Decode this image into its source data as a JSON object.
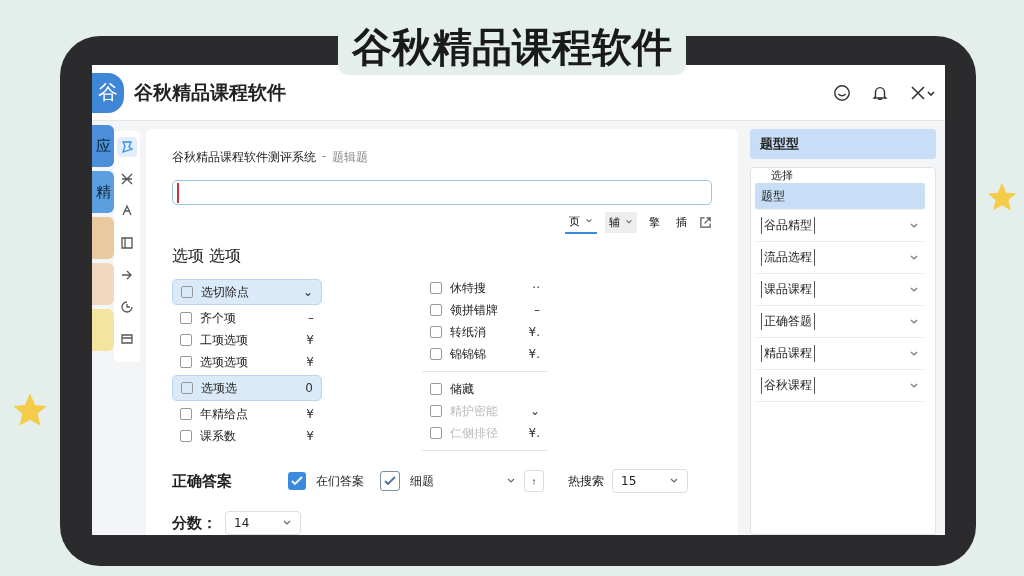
{
  "poster_title": "谷秋精品课程软件",
  "app": {
    "logo": "谷",
    "title": "谷秋精品课程软件"
  },
  "dock": [
    {
      "label": "应",
      "color": "#4a8fd8"
    },
    {
      "label": "精",
      "color": "#5aa0e0"
    },
    {
      "color": "#e9c9a0"
    },
    {
      "color": "#f1d6c0"
    },
    {
      "color": "#f5e3a0"
    }
  ],
  "rail": [
    {
      "selected": true
    },
    {
      "selected": false
    },
    {
      "selected": false
    },
    {
      "selected": false
    },
    {
      "selected": false
    },
    {
      "selected": false
    },
    {
      "selected": false
    }
  ],
  "breadcrumb": {
    "root": "谷秋精品课程软件测评系统",
    "sep": "-",
    "current": "题辑题"
  },
  "editor": {
    "toolbar": [
      {
        "label": "页",
        "caret": true,
        "selected": true
      },
      {
        "label": "辅",
        "caret": true,
        "selected": false
      },
      {
        "label": "擎",
        "caret": false,
        "selected": false
      },
      {
        "label": "插",
        "caret": false,
        "selected": false
      }
    ]
  },
  "options_title": "选项 选项",
  "options_left": [
    {
      "label": "选切除点",
      "suffix": "⌄",
      "checked": false,
      "selected": true
    },
    {
      "label": "齐个项",
      "suffix": "–",
      "checked": false,
      "selected": false
    },
    {
      "label": "工项选项",
      "suffix": "¥",
      "checked": false,
      "selected": false
    },
    {
      "label": "选项选项",
      "suffix": "¥",
      "checked": false,
      "selected": false
    },
    {
      "label": "选项选",
      "suffix": "0",
      "checked": false,
      "selected": true
    },
    {
      "label": "年精给点",
      "suffix": "¥",
      "checked": false,
      "selected": false
    },
    {
      "label": "课系数",
      "suffix": "¥",
      "checked": false,
      "selected": false
    }
  ],
  "options_right": [
    [
      {
        "label": "休特搜",
        "suffix": "··",
        "checked": false,
        "disabled": false
      },
      {
        "label": "领拼错牌",
        "suffix": "–",
        "checked": false,
        "disabled": false
      },
      {
        "label": "转纸消",
        "suffix": "¥.",
        "checked": false,
        "disabled": false
      },
      {
        "label": "锦锦锦",
        "suffix": "¥.",
        "checked": false,
        "disabled": false
      }
    ],
    [
      {
        "label": "储藏",
        "checked": false,
        "disabled": false
      },
      {
        "label": "精护密能",
        "suffix": "⌄",
        "checked": false,
        "disabled": true
      },
      {
        "label": "仁侧排径",
        "suffix": "¥.",
        "checked": false,
        "disabled": true
      }
    ]
  ],
  "answer": {
    "label": "正确答案",
    "choices": [
      {
        "label": "在们答案",
        "checked": true,
        "kind": "filled"
      },
      {
        "label": "细题",
        "checked": true,
        "kind": "outline"
      }
    ],
    "up": "↑",
    "search_label": "热搜索",
    "search_value": "15"
  },
  "score": {
    "label": "分数：",
    "value": "14"
  },
  "types": {
    "header": "题型型",
    "caption": "选择",
    "items": [
      {
        "label": "题型",
        "selected": true,
        "kind": "plain"
      },
      {
        "label": "谷品精型",
        "selected": false,
        "kind": "tag"
      },
      {
        "label": "流品选程",
        "selected": false,
        "kind": "tag"
      },
      {
        "label": "课品课程",
        "selected": false,
        "kind": "tag"
      },
      {
        "label": "正确答题",
        "selected": false,
        "kind": "tag"
      },
      {
        "label": "精品课程",
        "selected": false,
        "kind": "tag"
      },
      {
        "label": "谷秋课程",
        "selected": false,
        "kind": "tag"
      }
    ]
  }
}
